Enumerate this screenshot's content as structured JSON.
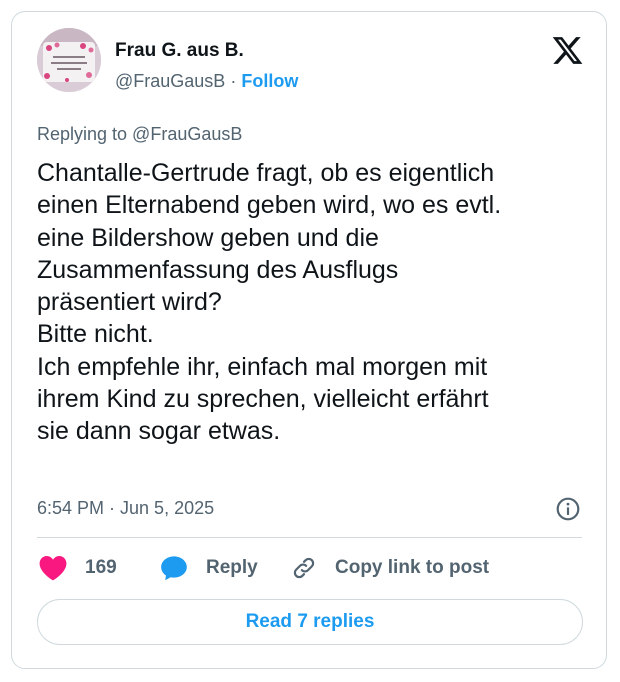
{
  "author": {
    "name": "Frau G. aus B.",
    "handle": "@FrauGausB",
    "separator": "·",
    "follow_label": "Follow"
  },
  "replying_to": "Replying to @FrauGausB",
  "body_lines": [
    "Chantalle-Gertrude fragt, ob es eigentlich",
    "einen Elternabend geben wird, wo es evtl.",
    "eine Bildershow geben und die",
    "Zusammenfassung des Ausflugs",
    "präsentiert wird?",
    "Bitte nicht.",
    "Ich empfehle ihr, einfach mal morgen mit",
    "ihrem Kind zu sprechen, vielleicht erfährt",
    "sie dann sogar etwas."
  ],
  "timestamp": "6:54 PM · Jun 5, 2025",
  "actions": {
    "like_count": "169",
    "reply_label": "Reply",
    "copy_link_label": "Copy link to post"
  },
  "read_replies_label": "Read 7 replies",
  "colors": {
    "accent": "#1d9bf0",
    "like": "#f91880",
    "secondary_text": "#536471",
    "border": "#cfd9de"
  },
  "icons": [
    "x-logo-icon",
    "info-icon",
    "heart-icon",
    "reply-bubble-icon",
    "link-icon"
  ]
}
